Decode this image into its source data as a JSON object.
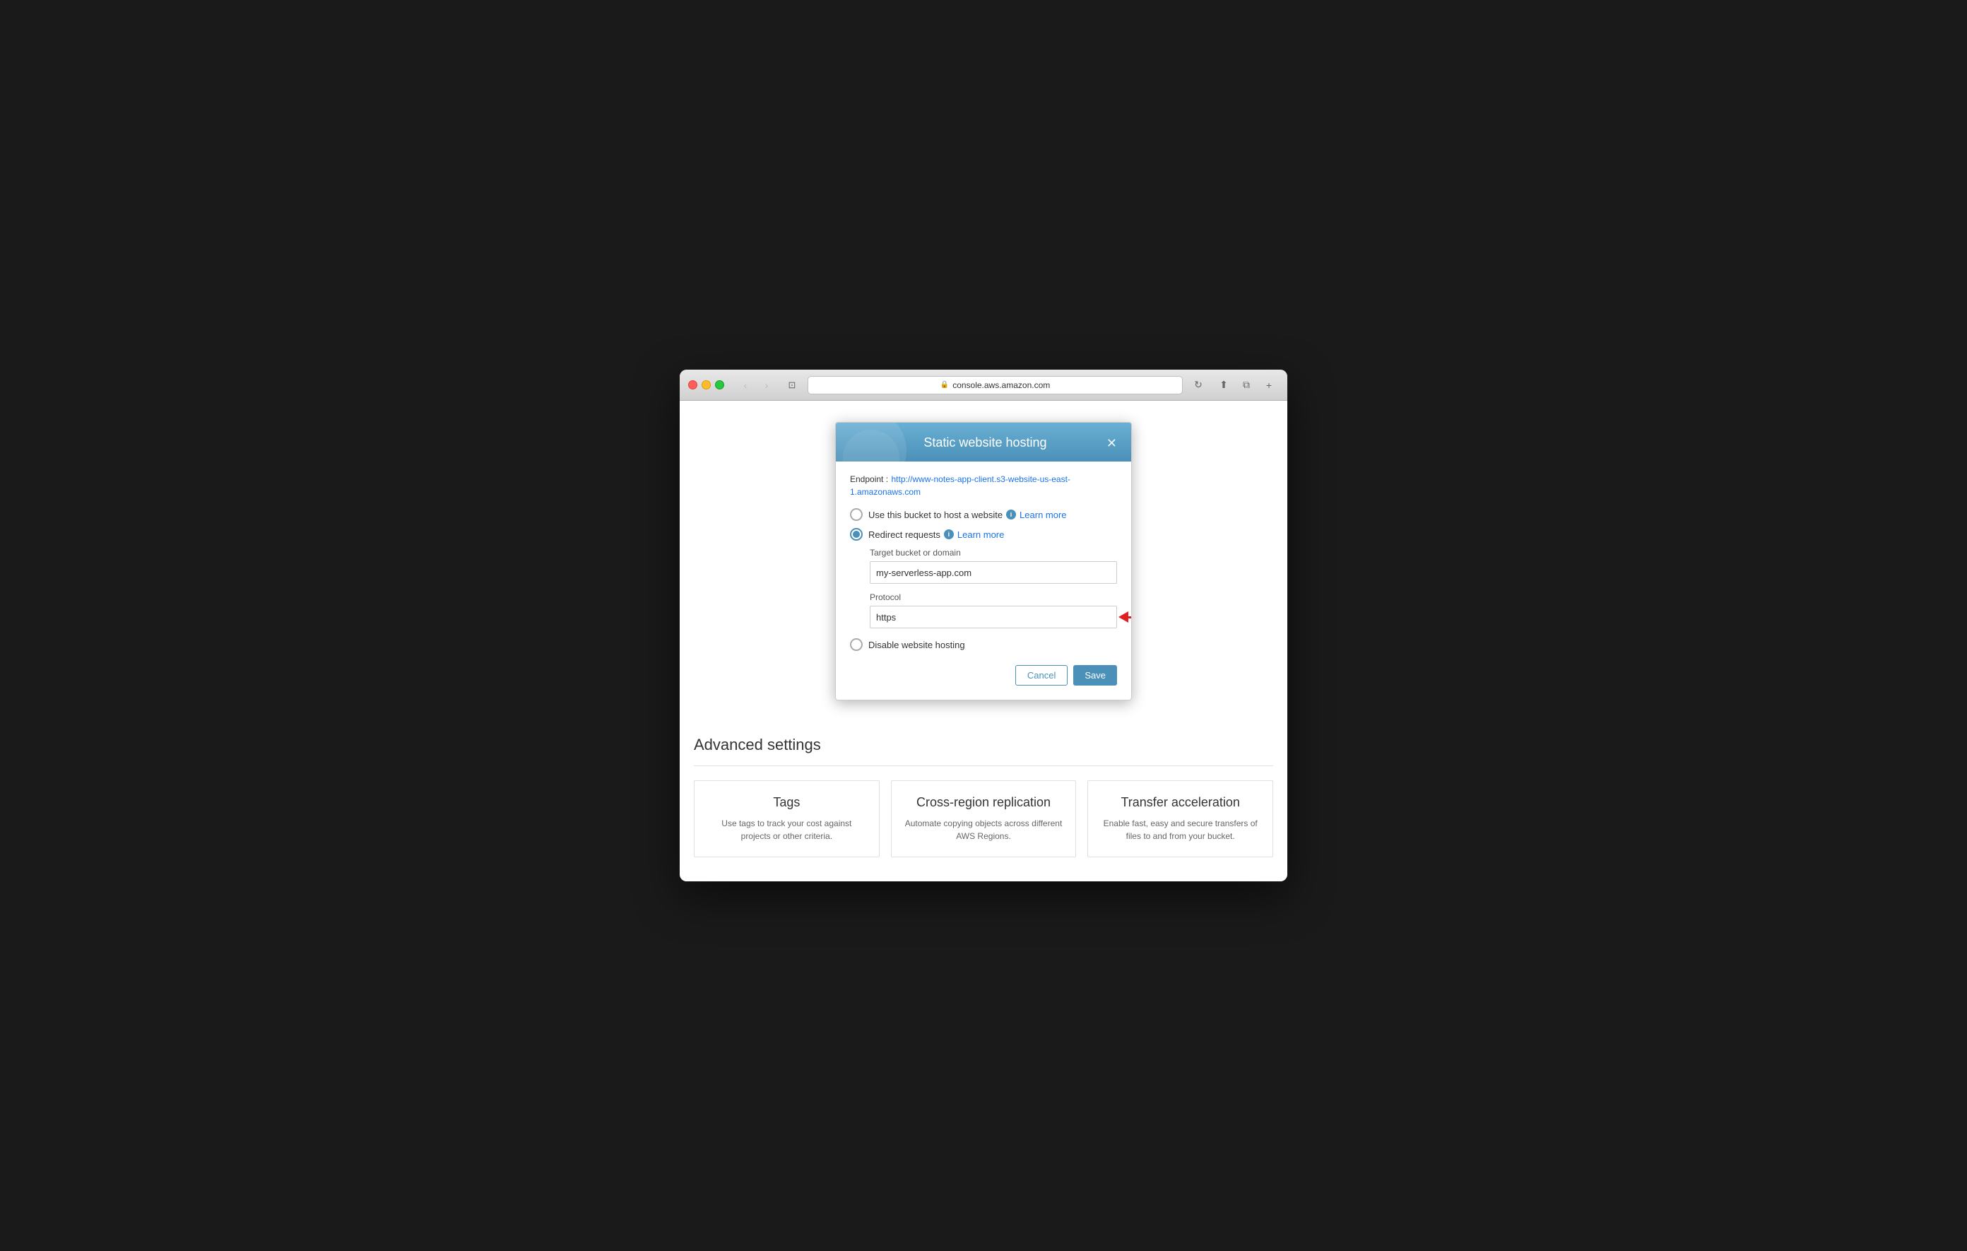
{
  "browser": {
    "url": "console.aws.amazon.com",
    "back_disabled": true,
    "forward_disabled": true
  },
  "modal": {
    "title": "Static website hosting",
    "endpoint_label": "Endpoint :",
    "endpoint_url": "http://www-notes-app-client.s3-website-us-east-1.amazonaws.com",
    "option_host": "Use this bucket to host a website",
    "option_redirect": "Redirect requests",
    "option_disable": "Disable website hosting",
    "learn_more_1": "Learn more",
    "learn_more_2": "Learn more",
    "target_bucket_label": "Target bucket or domain",
    "target_bucket_value": "my-serverless-app.com",
    "protocol_label": "Protocol",
    "protocol_value": "https",
    "cancel_label": "Cancel",
    "save_label": "Save"
  },
  "advanced": {
    "section_title": "Advanced settings",
    "cards": [
      {
        "title": "Tags",
        "description": "Use tags to track your cost against projects or other criteria."
      },
      {
        "title": "Cross-region replication",
        "description": "Automate copying objects across different AWS Regions."
      },
      {
        "title": "Transfer acceleration",
        "description": "Enable fast, easy and secure transfers of files to and from your bucket."
      }
    ]
  }
}
